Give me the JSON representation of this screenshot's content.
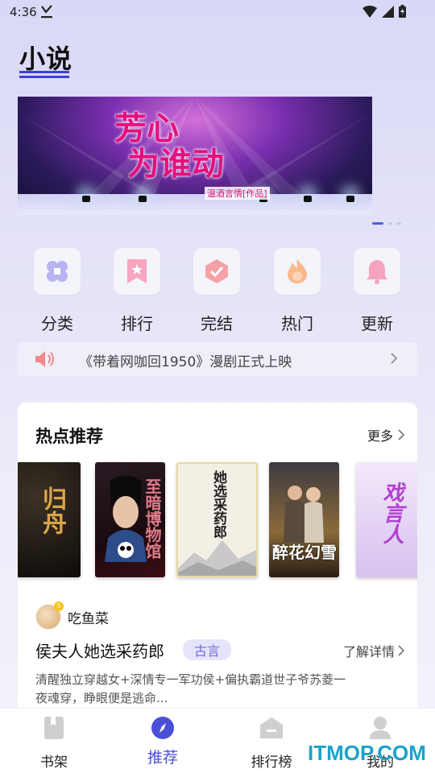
{
  "status_bar": {
    "time": "4:36"
  },
  "header": {
    "title": "小说"
  },
  "banner": {
    "title_line1": "芳心",
    "title_line2": "为谁动",
    "subtitle": "温酒言情[作品]",
    "slide_count": 4,
    "active_slide": 1
  },
  "categories": [
    {
      "label": "分类",
      "icon": "grid-icon"
    },
    {
      "label": "排行",
      "icon": "ranking-bookmark-icon"
    },
    {
      "label": "完结",
      "icon": "check-badge-icon"
    },
    {
      "label": "热门",
      "icon": "fire-icon"
    },
    {
      "label": "更新",
      "icon": "bell-icon"
    }
  ],
  "notice": {
    "text": "《带着网咖回1950》漫剧正式上映"
  },
  "hot": {
    "title": "热点推荐",
    "more": "更多",
    "books": [
      {
        "cover_title": "归舟",
        "cover_color": "#1a1410"
      },
      {
        "cover_title": "至暗博物馆",
        "cover_color": "#2a0a0e"
      },
      {
        "cover_title": "她选采药郎",
        "cover_color": "#f4efe4"
      },
      {
        "cover_title": "醉花幻雪",
        "cover_color": "#3a3022"
      },
      {
        "cover_title": "戏言人",
        "cover_color": "#e8d9f3"
      }
    ],
    "featured": {
      "author": "吃鱼菜",
      "title": "侯夫人她选采药郎",
      "genre": "古言",
      "detail": "了解详情",
      "description": "清醒独立穿越女+深情专一军功侯+偏执霸道世子爷苏菱一夜魂穿，睁眼便是逃命..."
    }
  },
  "bottom_nav": [
    {
      "label": "书架",
      "icon": "bookshelf-icon"
    },
    {
      "label": "推荐",
      "icon": "compass-icon",
      "active": true
    },
    {
      "label": "排行榜",
      "icon": "ranking-icon"
    },
    {
      "label": "我的",
      "icon": "profile-icon"
    }
  ],
  "watermark": "ITMOP.COM",
  "colors": {
    "accent": "#4b4fd8",
    "tag_bg": "#e5e4fa",
    "banner_title": "#e3117f"
  }
}
